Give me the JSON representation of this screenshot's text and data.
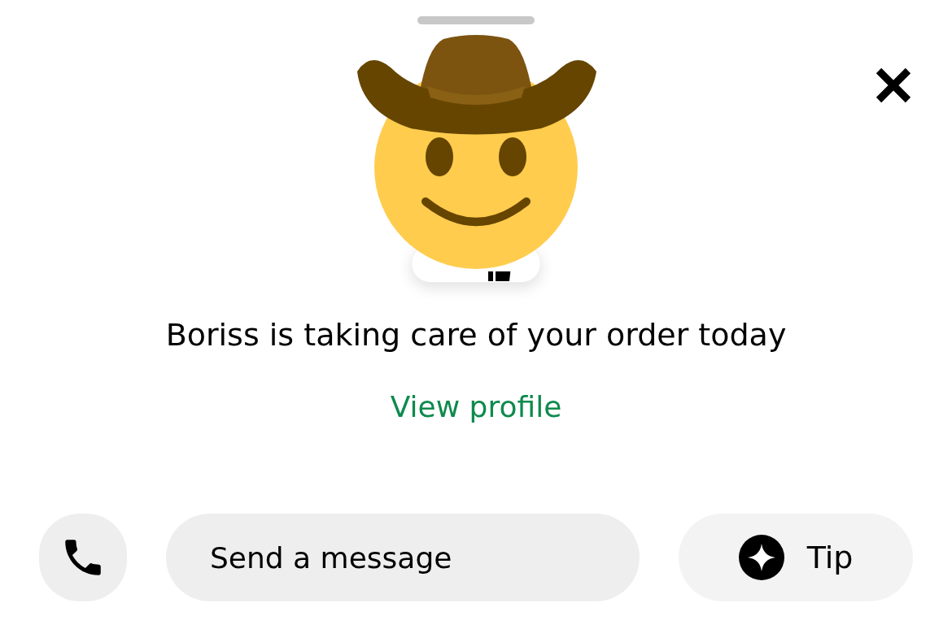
{
  "courier": {
    "headline": "Boriss is taking care of your order today"
  },
  "view_profile_link": "View profile",
  "message_field": {
    "placeholder": "Send a message"
  },
  "tip_button": {
    "label": "Tip"
  }
}
